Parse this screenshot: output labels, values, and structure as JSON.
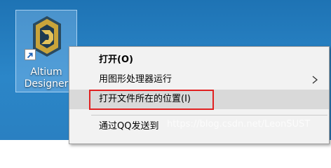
{
  "desktop": {
    "icon": {
      "label_line1": "Altium",
      "label_line2": "Designer",
      "logo_icon": "altium-logo-icon",
      "shortcut_icon": "shortcut-arrow-icon"
    }
  },
  "context_menu": {
    "items": [
      {
        "label": "打开(O)",
        "bold": true
      },
      {
        "label": "用图形处理器运行",
        "has_submenu": true
      },
      {
        "label": "打开文件所在的位置(I)",
        "highlighted": true
      },
      {
        "label": "通过QQ发送到"
      }
    ],
    "highlight_color": "#e02020"
  },
  "watermark": "https://blog.csdn.net/LeonSUST",
  "colors": {
    "desktop_bg": "#2b86c8",
    "menu_bg": "#f2f2f2",
    "hover_bg": "#d9d9d9",
    "logo_gold": "#c9a43a"
  }
}
